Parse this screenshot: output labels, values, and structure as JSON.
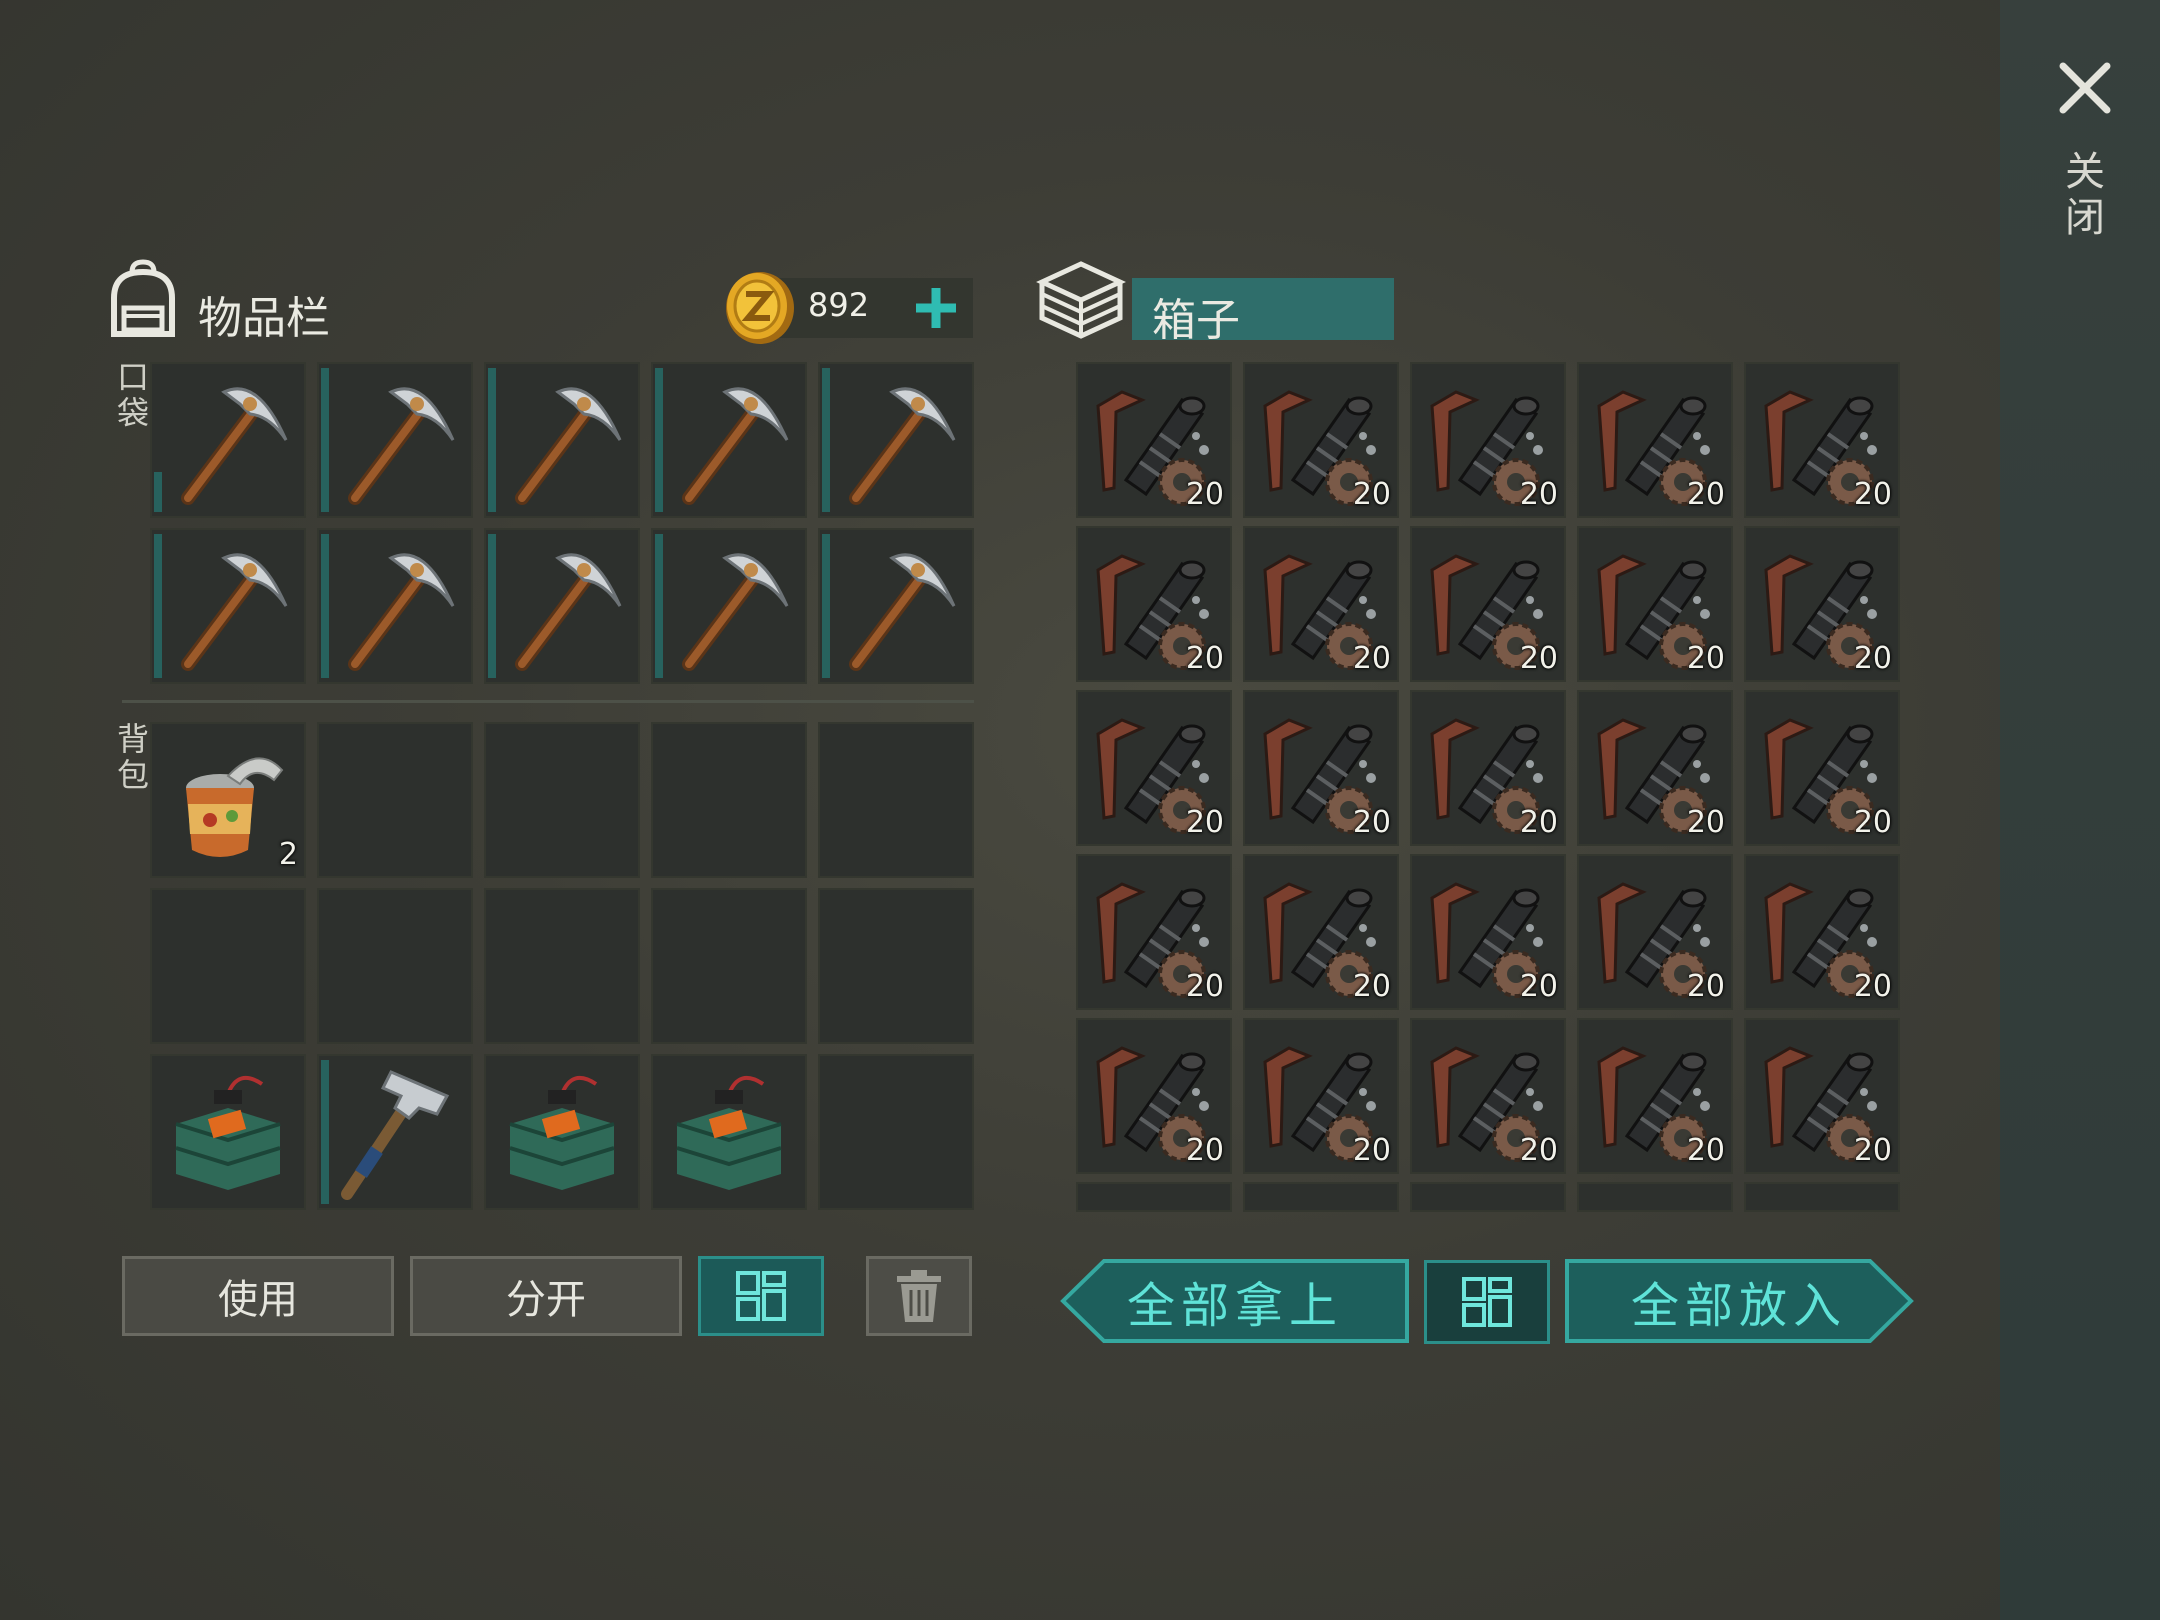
{
  "inventory": {
    "title": "物品栏",
    "coins": "892",
    "pocket_label": "口袋",
    "backpack_label": "背包",
    "pocket_slots": [
      {
        "item": "pickaxe",
        "durability": "low"
      },
      {
        "item": "pickaxe",
        "durability": "full"
      },
      {
        "item": "pickaxe",
        "durability": "full"
      },
      {
        "item": "pickaxe",
        "durability": "full"
      },
      {
        "item": "pickaxe",
        "durability": "full"
      },
      {
        "item": "pickaxe",
        "durability": "full"
      },
      {
        "item": "pickaxe",
        "durability": "full"
      },
      {
        "item": "pickaxe",
        "durability": "full"
      },
      {
        "item": "pickaxe",
        "durability": "full"
      },
      {
        "item": "pickaxe",
        "durability": "full"
      }
    ],
    "backpack_slots": [
      {
        "item": "canned-food",
        "count": "2"
      },
      {
        "item": ""
      },
      {
        "item": ""
      },
      {
        "item": ""
      },
      {
        "item": ""
      },
      {
        "item": ""
      },
      {
        "item": ""
      },
      {
        "item": ""
      },
      {
        "item": ""
      },
      {
        "item": ""
      },
      {
        "item": "c4-explosive"
      },
      {
        "item": "hammer",
        "durability": "full"
      },
      {
        "item": "c4-explosive"
      },
      {
        "item": "c4-explosive"
      },
      {
        "item": ""
      }
    ],
    "buttons": {
      "use": "使用",
      "split": "分开"
    }
  },
  "crate": {
    "title": "箱子",
    "slot_count_label": "20",
    "slot_item": "gun-parts",
    "visible_rows": 5,
    "columns": 5,
    "buttons": {
      "take_all": "全部拿上",
      "put_all": "全部放入"
    }
  },
  "close_label": "关闭",
  "colors": {
    "accent": "#2f6e6b",
    "accent_text": "#5fe3d8",
    "durability": "#27625e"
  }
}
